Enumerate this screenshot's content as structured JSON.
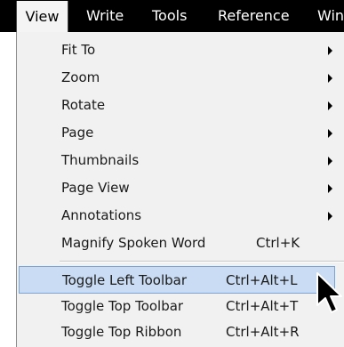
{
  "menubar": {
    "items": [
      {
        "label": "View",
        "active": true
      },
      {
        "label": "Write"
      },
      {
        "label": "Tools"
      },
      {
        "label": "Reference"
      },
      {
        "label": "Win"
      }
    ]
  },
  "menu": {
    "items": [
      {
        "label": "Fit To",
        "submenu": true
      },
      {
        "label": "Zoom",
        "submenu": true
      },
      {
        "label": "Rotate",
        "submenu": true
      },
      {
        "label": "Page",
        "submenu": true
      },
      {
        "label": "Thumbnails",
        "submenu": true
      },
      {
        "label": "Page View",
        "submenu": true
      },
      {
        "label": "Annotations",
        "submenu": true
      },
      {
        "label": "Magnify Spoken Word",
        "shortcut": "Ctrl+K"
      },
      {
        "label": "Toggle Left Toolbar",
        "shortcut": "Ctrl+Alt+L",
        "highlighted": true
      },
      {
        "label": "Toggle Top Toolbar",
        "shortcut": "Ctrl+Alt+T"
      },
      {
        "label": "Toggle Top Ribbon",
        "shortcut": "Ctrl+Alt+R"
      }
    ]
  },
  "colors": {
    "menubar_bg": "#000000",
    "menu_bg": "#f1f1f1",
    "highlight_bg": "#c9dcf3",
    "highlight_border": "#7aa3d6"
  },
  "icons": {
    "submenu": "triangle-right-icon",
    "pointer": "mouse-pointer-icon"
  }
}
